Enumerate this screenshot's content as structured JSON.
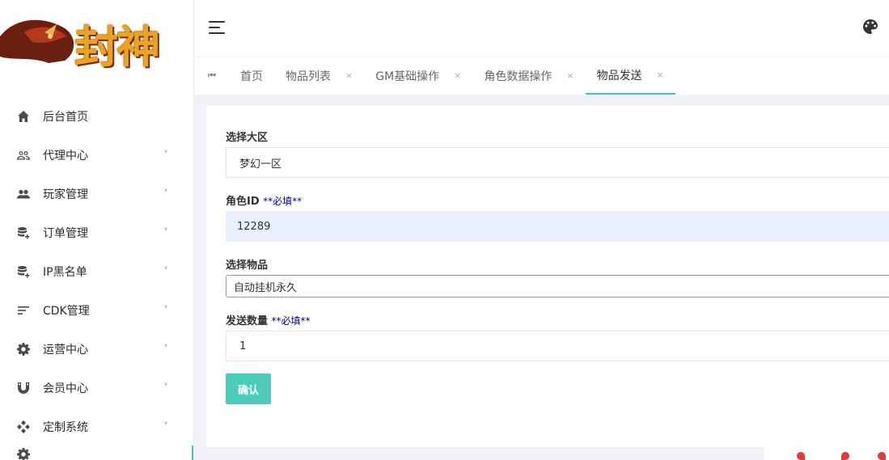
{
  "logo": {
    "text": "封神"
  },
  "sidebar": {
    "items": [
      {
        "label": "后台首页",
        "icon": "home-icon",
        "has_arrow": false
      },
      {
        "label": "代理中心",
        "icon": "users-outline-icon",
        "has_arrow": true
      },
      {
        "label": "玩家管理",
        "icon": "users-icon",
        "has_arrow": true
      },
      {
        "label": "订单管理",
        "icon": "database-plus-icon",
        "has_arrow": true
      },
      {
        "label": "IP黑名单",
        "icon": "database-plus-icon",
        "has_arrow": true
      },
      {
        "label": "CDK管理",
        "icon": "list-icon",
        "has_arrow": true
      },
      {
        "label": "运营中心",
        "icon": "gear-icon",
        "has_arrow": true
      },
      {
        "label": "会员中心",
        "icon": "magnet-icon",
        "has_arrow": true
      },
      {
        "label": "定制系统",
        "icon": "diamond-icon",
        "has_arrow": true
      }
    ],
    "arrow_glyph": "›",
    "accent": "#44c4c4"
  },
  "tabs": {
    "home_arrow": "⏮",
    "items": [
      {
        "label": "首页",
        "closable": false,
        "active": false
      },
      {
        "label": "物品列表",
        "closable": true,
        "active": false
      },
      {
        "label": "GM基础操作",
        "closable": true,
        "active": false
      },
      {
        "label": "角色数据操作",
        "closable": true,
        "active": false
      },
      {
        "label": "物品发送",
        "closable": true,
        "active": true
      }
    ],
    "close_glyph": "×"
  },
  "form": {
    "region_label": "选择大区",
    "region_value": "梦幻一区",
    "role_id_label": "角色ID",
    "role_id_required": "**必填**",
    "role_id_value": "12289",
    "item_label": "选择物品",
    "item_value": "自动挂机永久",
    "quantity_label": "发送数量",
    "quantity_required": "**必填**",
    "quantity_value": "1",
    "submit_label": "确认"
  },
  "colors": {
    "button": "#4bcbb9",
    "tab_active": "#44c4c4",
    "required_text": "#000080"
  }
}
